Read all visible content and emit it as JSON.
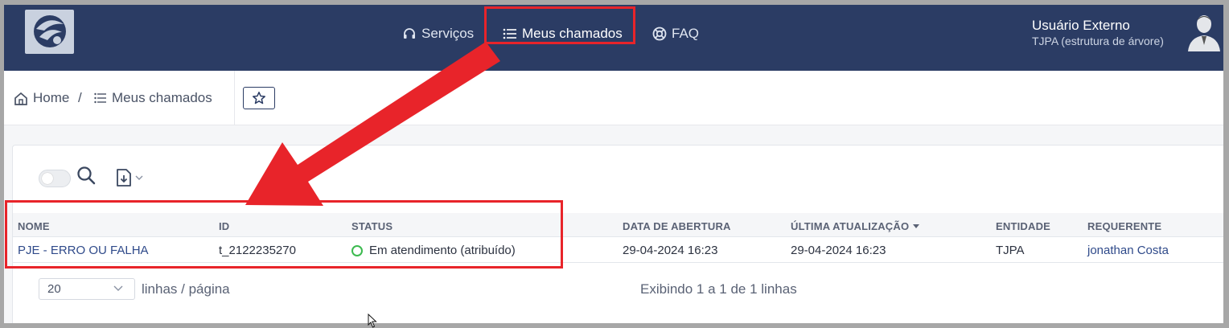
{
  "nav": {
    "services": "Serviços",
    "my_tickets": "Meus chamados",
    "faq": "FAQ"
  },
  "user": {
    "name": "Usuário Externo",
    "org": "TJPA (estrutura de árvore)"
  },
  "breadcrumb": {
    "home": "Home",
    "separator": "/",
    "current": "Meus chamados"
  },
  "table": {
    "columns": [
      "NOME",
      "ID",
      "STATUS",
      "DATA DE ABERTURA",
      "ÚLTIMA ATUALIZAÇÃO",
      "ENTIDADE",
      "REQUERENTE"
    ],
    "rows": [
      {
        "nome": "PJE - ERRO OU FALHA",
        "id": "t_2122235270",
        "status": "Em atendimento (atribuído)",
        "data_abertura": "29-04-2024 16:23",
        "ultima_atualizacao": "29-04-2024 16:23",
        "entidade": "TJPA",
        "requerente": "jonathan Costa"
      }
    ]
  },
  "pager": {
    "page_size": "20",
    "rows_per_page_label": "linhas / página",
    "info": "Exibindo 1 a 1 de 1 linhas"
  },
  "colors": {
    "nav_bg": "#2b3c64",
    "annotation_red": "#e8242a",
    "status_green": "#3cba4f",
    "link_blue": "#2f4a8a"
  }
}
